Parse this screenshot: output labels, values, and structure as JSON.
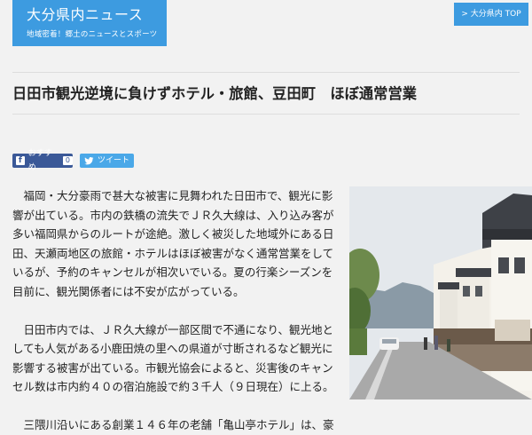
{
  "site": {
    "title": "大分県内ニュース",
    "tagline": "地域密着！郷土のニュースとスポーツ",
    "top_link_label": "大分県内 TOP",
    "top_link_icon": "chevron-right-icon"
  },
  "article": {
    "title": "日田市観光逆境に負けずホテル・旅館、豆田町　ほぼ通常営業",
    "paragraphs": [
      "福岡・大分豪雨で甚大な被害に見舞われた日田市で、観光に影響が出ている。市内の鉄橋の流失でＪＲ久大線は、入り込み客が多い福岡県からのルートが途絶。激しく被災した地域外にある日田、天瀬両地区の旅館・ホテルはほぼ被害がなく通常営業をしているが、予約のキャンセルが相次いでいる。夏の行楽シーズンを目前に、観光関係者には不安が広がっている。",
      "日田市内では、ＪＲ久大線が一部区間で不通になり、観光地としても人気がある小鹿田焼の里への県道が寸断されるなど観光に影響する被害が出ている。市観光協会によると、災害後のキャンセル数は市内約４０の宿泊施設で約３千人（９日現在）に上る。",
      "三隈川沿いにある創業１４６年の老舗「亀山亭ホテル」は、豪"
    ]
  },
  "share": {
    "facebook_label": "おすすめ",
    "facebook_count": "0",
    "facebook_icon": "facebook-icon",
    "twitter_label": "ツイート",
    "twitter_icon": "twitter-bird-icon"
  },
  "photo": {
    "subject": "street-with-white-storehouses-photo"
  },
  "colors": {
    "accent": "#3d9be0",
    "facebook": "#3b5998",
    "twitter": "#4aa8e8",
    "background": "#f2f2f2"
  }
}
